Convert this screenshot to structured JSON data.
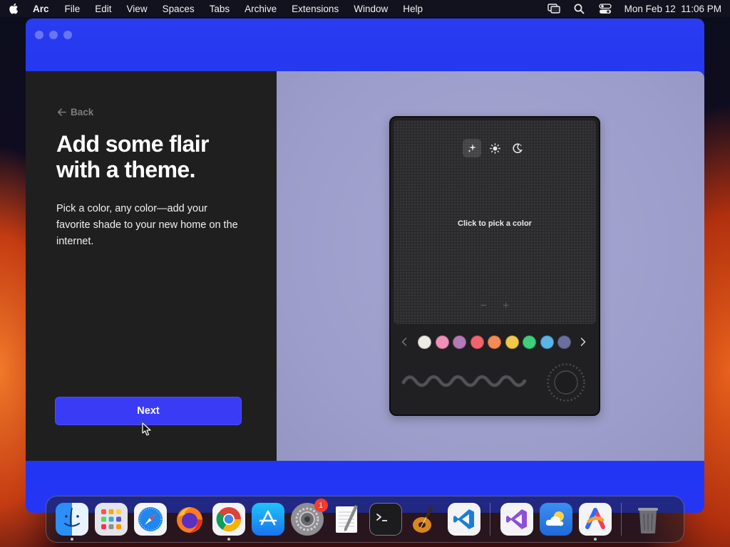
{
  "menubar": {
    "app_name": "Arc",
    "items": [
      "File",
      "Edit",
      "View",
      "Spaces",
      "Tabs",
      "Archive",
      "Extensions",
      "Window",
      "Help"
    ],
    "datetime": "Mon Feb 12  11:06 PM",
    "status_icons": [
      "screen-mirroring-icon",
      "search-icon",
      "control-center-icon"
    ]
  },
  "onboarding": {
    "back_label": "Back",
    "headline": "Add some flair with a theme.",
    "description": "Pick a color, any color—add your favorite shade to your new home on the internet.",
    "next_label": "Next"
  },
  "theme_picker": {
    "modes": [
      "auto-sparkle-icon",
      "light-sun-icon",
      "dark-moon-icon"
    ],
    "active_mode": "auto-sparkle-icon",
    "prompt": "Click to pick a color",
    "minus_label": "−",
    "plus_label": "+",
    "swatch_colors": [
      "#ecebe6",
      "#f08fb8",
      "#b37ab7",
      "#f2646d",
      "#f58a55",
      "#f3c84a",
      "#3fcf7c",
      "#5ab4e6",
      "#6b6f9c"
    ]
  },
  "dock": {
    "apps": [
      "Finder",
      "Launchpad",
      "Safari",
      "Firefox",
      "Chrome",
      "App Store",
      "System Settings",
      "TextEdit",
      "Terminal",
      "GarageBand",
      "Visual Studio Code",
      "Visual Studio",
      "Weather",
      "Arc",
      "Trash"
    ],
    "system_settings_badge": "1"
  },
  "colors": {
    "accent": "#3a3cf5",
    "window_frame": "#2436f4",
    "left_panel": "#1f1f20",
    "right_panel": "#9c9dca"
  }
}
